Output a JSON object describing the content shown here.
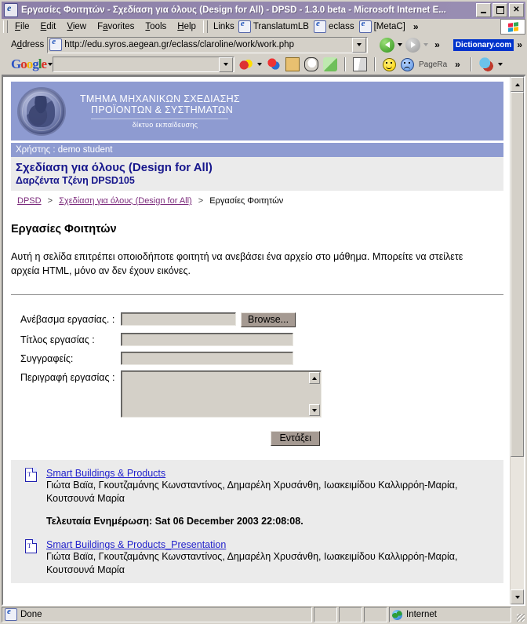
{
  "window": {
    "title": "Εργασίες Φοιτητών - Σχεδίαση για όλους (Design for All) - DPSD - 1.3.0 beta - Microsoft Internet E...",
    "minimize_label": "",
    "maximize_label": "",
    "close_label": "✕"
  },
  "menu": {
    "items": [
      {
        "label": "File",
        "accel": "F"
      },
      {
        "label": "Edit",
        "accel": "E"
      },
      {
        "label": "View",
        "accel": "V"
      },
      {
        "label": "Favorites",
        "accel": "a"
      },
      {
        "label": "Tools",
        "accel": "T"
      },
      {
        "label": "Help",
        "accel": "H"
      }
    ]
  },
  "links_bar": {
    "label": "Links",
    "items": [
      "TranslatumLB",
      "eclass",
      "[MetaC]"
    ],
    "overflow": "»"
  },
  "address_bar": {
    "label": "Address",
    "url": "http://edu.syros.aegean.gr/eclass/claroline/work/work.php",
    "overflow": "»",
    "dictionary_button": "Dictionary.com",
    "dictionary_overflow": "»"
  },
  "google_toolbar": {
    "logo": "Google",
    "search_value": "",
    "pagerank_label": "PageRa",
    "overflow": "»"
  },
  "site": {
    "banner_line1": "ΤΜΗΜΑ ΜΗΧΑΝΙΚΩΝ ΣΧΕΔΙΑΣΗΣ",
    "banner_line2": "ΠΡΟΪΟΝΤΩΝ & ΣΥΣΤΗΜΑΤΩΝ",
    "banner_line3": "δίκτυο εκπαίδευσης",
    "user_line": "Χρήστης : demo student",
    "course_title": "Σχεδίαση για όλους (Design for All)",
    "course_subtitle": "Δαρζέντα Τζένη DPSD105",
    "accent_color": "#8e9bd1",
    "link_color": "#2222cc",
    "crumb_link_color": "#7b2a7b"
  },
  "breadcrumb": {
    "items": [
      "DPSD",
      "Σχεδίαση για όλους (Design for All)",
      "Εργασίες Φοιτητών"
    ],
    "separator": ">"
  },
  "main": {
    "heading": "Εργασίες Φοιτητών",
    "intro": "Αυτή η σελίδα επιτρέπει οποιοδήποτε φοιτητή να ανεβάσει ένα αρχείο στο μάθημα. Μπορείτε να στείλετε αρχεία HTML, μόνο αν δεν έχουν εικόνες."
  },
  "form": {
    "upload_label": "Ανέβασμα εργασίας. :",
    "upload_value": "",
    "browse_button": "Browse...",
    "title_label": "Τίτλος εργασίας :",
    "title_value": "",
    "authors_label": "Συγγραφείς:",
    "authors_value": "",
    "description_label": "Περιγραφή εργασίας :",
    "description_value": "",
    "submit_button": "Εντάξει"
  },
  "files": [
    {
      "name": "Smart Buildings & Products",
      "authors": "Γιώτα Βαϊα, Γκουτζαμάνης Κωνσταντίνος, Δημαρέλη Χρυσάνθη, Ιωακειμίδου Καλλιρρόη-Μαρία, Κουτσουνά Μαρία",
      "updated": "Τελευταία Ενημέρωση: Sat 06 December 2003 22:08:08."
    },
    {
      "name": "Smart Buildings & Products_Presentation",
      "authors": "Γιώτα Βαϊα, Γκουτζαμάνης Κωνσταντίνος, Δημαρέλη Χρυσάνθη, Ιωακειμίδου Καλλιρρόη-Μαρία, Κουτσουνά Μαρία",
      "updated": ""
    }
  ],
  "status_bar": {
    "message": "Done",
    "zone": "Internet"
  }
}
